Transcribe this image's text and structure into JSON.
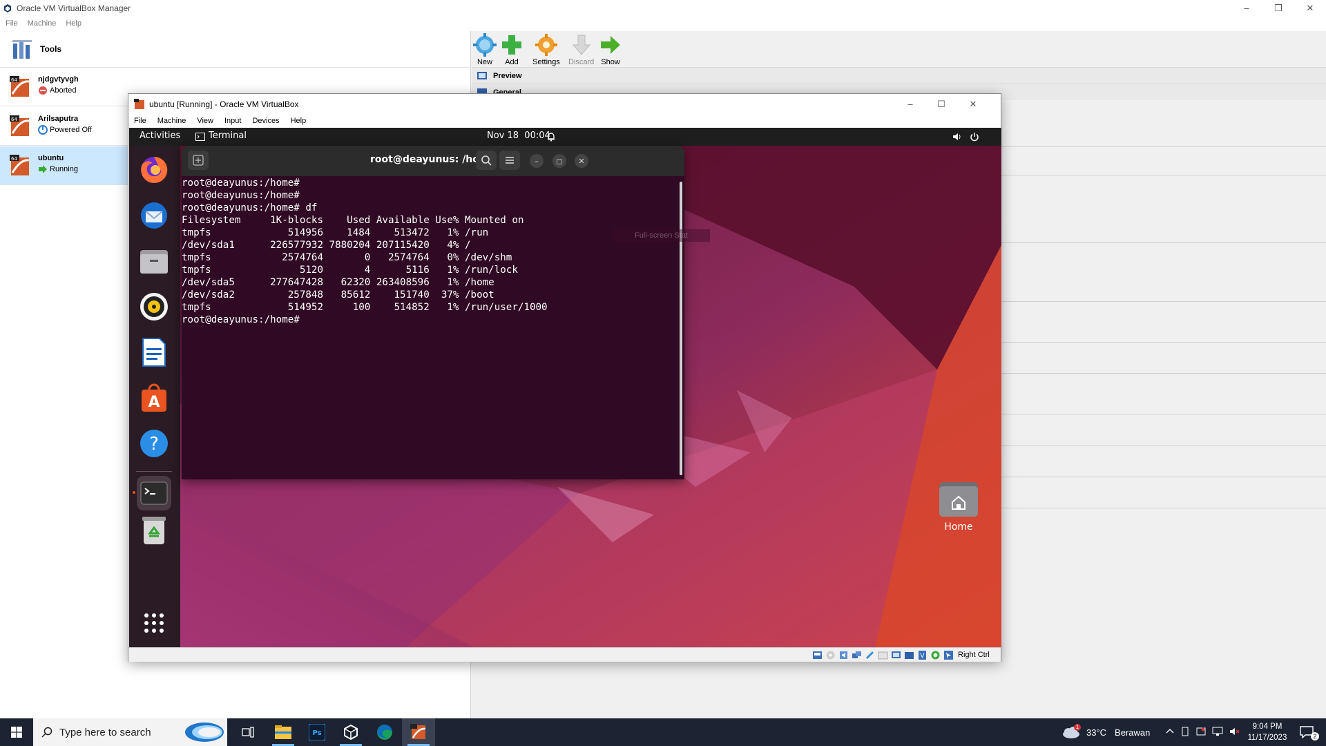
{
  "manager": {
    "title": "Oracle VM VirtualBox Manager",
    "menu": [
      "File",
      "Machine",
      "Help"
    ],
    "tools_label": "Tools",
    "vms": [
      {
        "name": "njdgvtyvgh",
        "state": "Aborted",
        "state_color": "#d9534f"
      },
      {
        "name": "Arilsaputra",
        "state": "Powered Off",
        "state_color": "#2a7fd4"
      },
      {
        "name": "ubuntu",
        "state": "Running",
        "state_color": "#3aa935"
      }
    ],
    "toolbar": {
      "new": "New",
      "add": "Add",
      "settings": "Settings",
      "discard": "Discard",
      "show": "Show"
    },
    "details": {
      "preview": "Preview",
      "general": "General"
    }
  },
  "vm_window": {
    "title": "ubuntu [Running] - Oracle VM VirtualBox",
    "menu": [
      "File",
      "Machine",
      "View",
      "Input",
      "Devices",
      "Help"
    ],
    "host_key": "Right Ctrl",
    "hint": "Full-screen Stat"
  },
  "ubuntu": {
    "activities": "Activities",
    "app_name": "Terminal",
    "datetime": "Nov 18  00:04",
    "desktop_icon": "Home",
    "terminal": {
      "title": "root@deayunus: /home",
      "lines": [
        "root@deayunus:/home#",
        "root@deayunus:/home#",
        "root@deayunus:/home# df",
        "Filesystem     1K-blocks    Used Available Use% Mounted on",
        "tmpfs             514956    1484    513472   1% /run",
        "/dev/sda1      226577932 7880204 207115420   4% /",
        "tmpfs            2574764       0   2574764   0% /dev/shm",
        "tmpfs               5120       4      5116   1% /run/lock",
        "/dev/sda5      277647428   62320 263408596   1% /home",
        "/dev/sda2         257848   85612    151740  37% /boot",
        "tmpfs             514952     100    514852   1% /run/user/1000",
        "root@deayunus:/home#"
      ]
    }
  },
  "taskbar": {
    "search_placeholder": "Type here to search",
    "weather_temp": "33°C",
    "weather_text": "Berawan",
    "time": "9:04 PM",
    "date": "11/17/2023",
    "notif_count": "2",
    "weather_badge": "1"
  },
  "colors": {
    "terminal_bg": "#300a24",
    "ubuntu_orange": "#e95420",
    "taskbar": "#1c2333",
    "selection": "#cce8ff"
  }
}
